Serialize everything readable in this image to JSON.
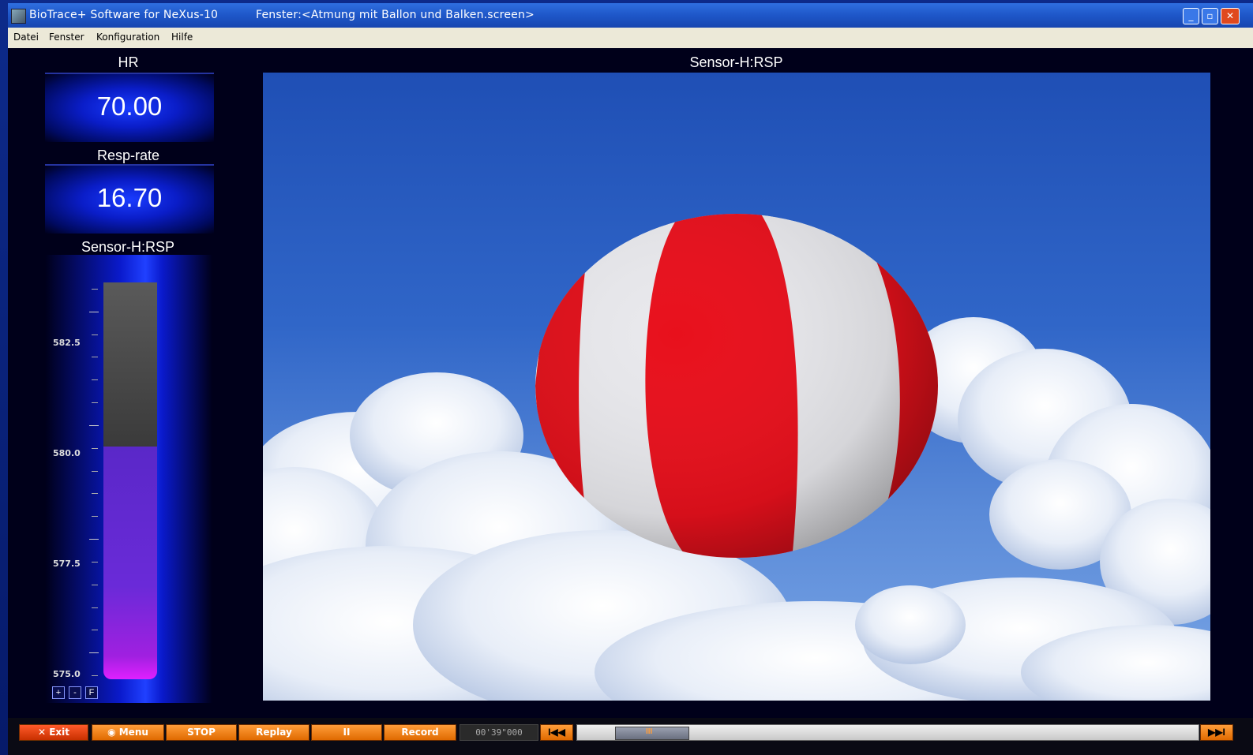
{
  "window": {
    "app_title": "BioTrace+ Software for NeXus-10",
    "screen_title": "Fenster:<Atmung mit Ballon und Balken.screen>",
    "controls": [
      "_",
      "▫",
      "✕"
    ]
  },
  "menu": [
    "Datei",
    "Fenster",
    "Konfiguration",
    "Hilfe"
  ],
  "hr": {
    "label": "HR",
    "value": "70.00"
  },
  "resp": {
    "label": "Resp-rate",
    "value": "16.70"
  },
  "bar": {
    "label": "Sensor-H:RSP",
    "ticks": [
      "582.5",
      "580.0",
      "577.5",
      "575.0"
    ],
    "min": 575.0,
    "max": 584.0,
    "value": 580.0,
    "buttons": [
      "+",
      "-",
      "F"
    ]
  },
  "scene": {
    "label": "Sensor-H:RSP"
  },
  "toolbar": {
    "exit": "Exit",
    "menu": "Menu",
    "stop": "STOP",
    "replay": "Replay",
    "pause": "II",
    "record": "Record",
    "time": "00'39\"000",
    "rewind": "I◀◀",
    "forward": "▶▶I",
    "thumb": "III"
  }
}
